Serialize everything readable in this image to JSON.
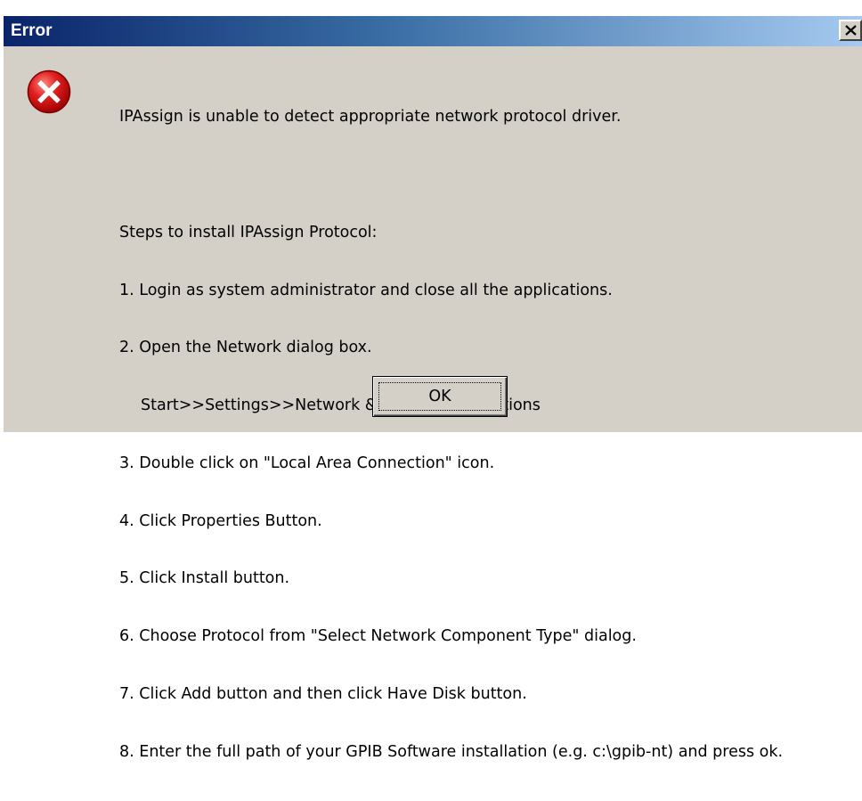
{
  "window": {
    "title": "Error",
    "close_icon": "close-icon"
  },
  "icon": {
    "name": "error-icon",
    "color": "#e02020"
  },
  "message": {
    "headline": "IPAssign is unable to detect appropriate network protocol driver.",
    "steps_header": "Steps to install IPAssign Protocol:",
    "steps": [
      "1. Login as system administrator and close all the applications.",
      "2. Open the Network dialog box.",
      "Start>>Settings>>Network & Dial-Up Connections",
      "3. Double click on \"Local Area Connection\" icon.",
      "4. Click Properties Button.",
      "5. Click Install button.",
      "6. Choose Protocol from \"Select Network Component Type\" dialog.",
      "7. Click Add button and then click Have Disk button.",
      "8. Enter the full path of your GPIB Software installation (e.g. c:\\gpib-nt) and press ok."
    ]
  },
  "buttons": {
    "ok_label": "OK"
  },
  "colors": {
    "titlebar_start": "#0a246a",
    "titlebar_end": "#a6caf0",
    "dialog_bg": "#d4d0c8"
  }
}
